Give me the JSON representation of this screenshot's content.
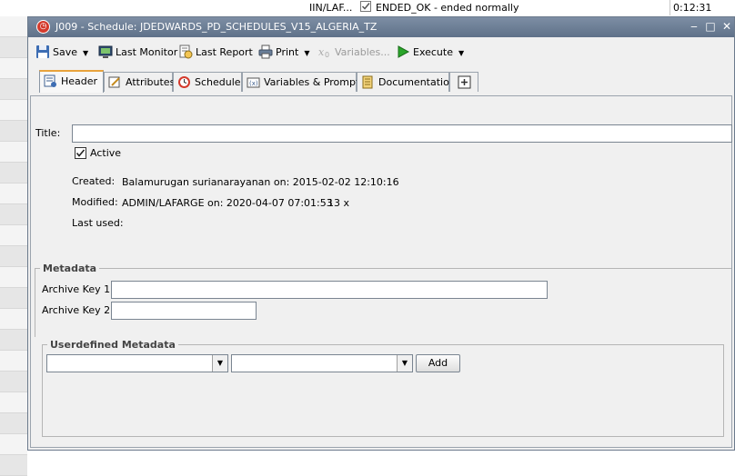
{
  "background_app": {
    "col_user": "IIN/LAF...",
    "col_status": "ENDED_OK - ended normally",
    "col_time": "0:12:31"
  },
  "window": {
    "title": "J009 - Schedule: JDEDWARDS_PD_SCHEDULES_V15_ALGERIA_TZ",
    "minimize": "‒",
    "maximize": "□",
    "close": "✕"
  },
  "toolbar": {
    "save": "Save",
    "last_monitor": "Last Monitor",
    "last_report": "Last Report",
    "print": "Print",
    "variables": "Variables...",
    "execute": "Execute"
  },
  "tabs": [
    {
      "label": "Header",
      "icon": "header-icon"
    },
    {
      "label": "Attributes",
      "icon": "attributes-icon"
    },
    {
      "label": "Schedule",
      "icon": "schedule-clock-icon"
    },
    {
      "label": "Variables & Prompts",
      "icon": "variables-icon"
    },
    {
      "label": "Documentation",
      "icon": "documentation-icon"
    },
    {
      "label": "",
      "icon": "add-tab-icon"
    }
  ],
  "header": {
    "title_label": "Title:",
    "title_value": "",
    "active_label": "Active",
    "active_checked": true,
    "created_label": "Created:",
    "created_value": "Balamurugan surianarayanan on: 2015-02-02 12:10:16",
    "modified_label": "Modified:",
    "modified_value": "ADMIN/LAFARGE on: 2020-04-07 07:01:53",
    "modified_count": "13 x",
    "last_used_label": "Last used:",
    "last_used_value": ""
  },
  "metadata": {
    "title": "Metadata",
    "archive_key1_label": "Archive Key 1:",
    "archive_key1_value": "",
    "archive_key2_label": "Archive Key 2:",
    "archive_key2_value": ""
  },
  "userdefined": {
    "title": "Userdefined Metadata",
    "combo1_value": "",
    "combo2_value": "",
    "add_label": "Add"
  },
  "colors": {
    "titlebar": "#6b7d95",
    "active_tab_accent": "#e8a33c",
    "execute_green": "#2aa52a"
  }
}
